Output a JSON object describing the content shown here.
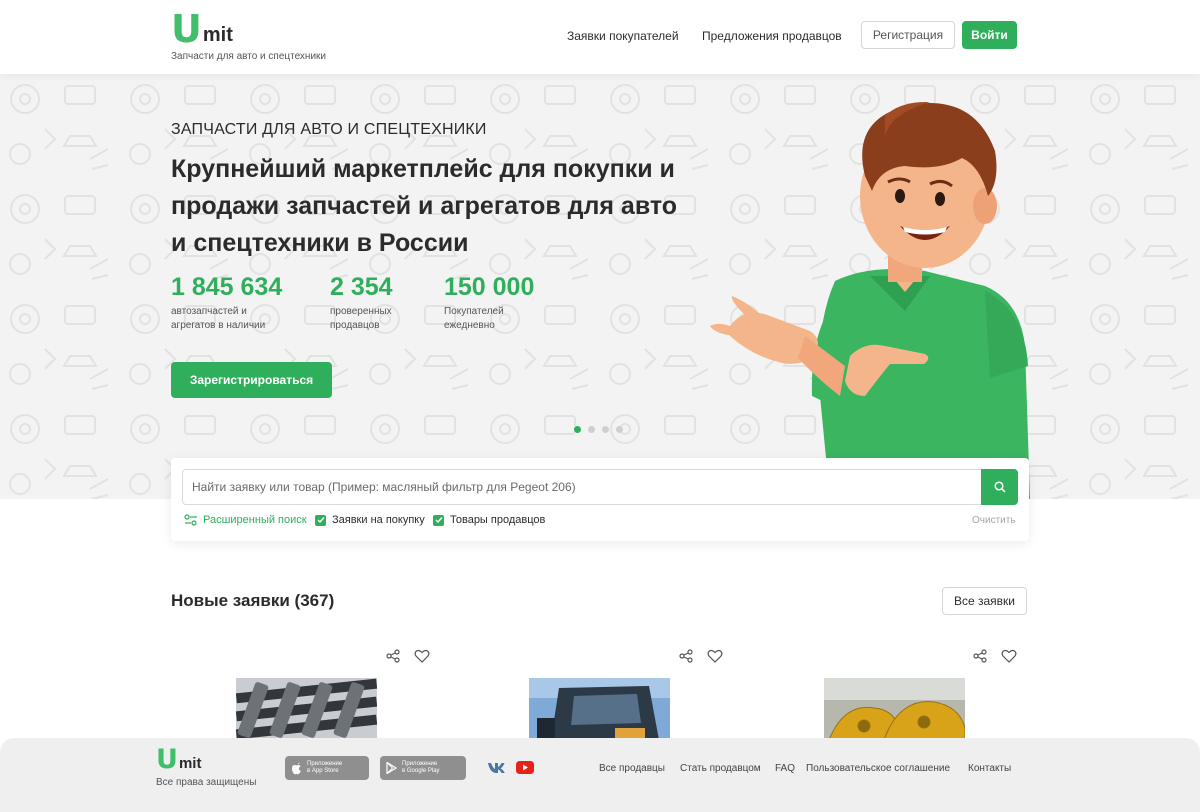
{
  "header": {
    "logo_u": "U",
    "logo_mit": "mit",
    "tagline": "Запчасти для авто и спецтехники",
    "nav": [
      "Заявки покупателей",
      "Предложения продавцов"
    ],
    "register_label": "Регистрация",
    "login_label": "Войти"
  },
  "hero": {
    "subtitle": "ЗАПЧАСТИ ДЛЯ АВТО И СПЕЦТЕХНИКИ",
    "title": "Крупнейший маркетплейс для покупки и продажи запчастей и агрегатов для авто и спецтехники в России",
    "stats": [
      {
        "value": "1 845 634",
        "label": "автозапчастей и агрегатов в наличии"
      },
      {
        "value": "2 354",
        "label": "проверенных продавцов"
      },
      {
        "value": "150 000",
        "label": "Покупателей ежедневно"
      }
    ],
    "cta_label": "Зарегистрироваться",
    "slides_total": 4,
    "slide_active": 1
  },
  "search": {
    "placeholder": "Найти заявку или товар (Пример: масляный фильтр для Pegeot 206)",
    "advanced_label": "Расширенный поиск",
    "checkbox_requests": "Заявки на покупку",
    "checkbox_products": "Товары продавцов",
    "clear_label": "Очистить"
  },
  "requests": {
    "title": "Новые заявки (367)",
    "all_label": "Все заявки"
  },
  "footer": {
    "logo_u": "U",
    "logo_mit": "mit",
    "rights": "Все права защищены",
    "appstore_line1": "Приложение",
    "appstore_line2": "в App Store",
    "googleplay_line1": "Приложение",
    "googleplay_line2": "в Google Play",
    "links": [
      "Все продавцы",
      "Стать продавцом",
      "FAQ",
      "Пользовательское соглашение",
      "Контакты"
    ]
  },
  "colors": {
    "accent": "#2fae5c",
    "logo_green": "#3fbf6a",
    "hero_bg": "#f3f3f3",
    "footer_bg": "#efefef",
    "vk_blue": "#4a76a8",
    "youtube_red": "#e62117"
  }
}
